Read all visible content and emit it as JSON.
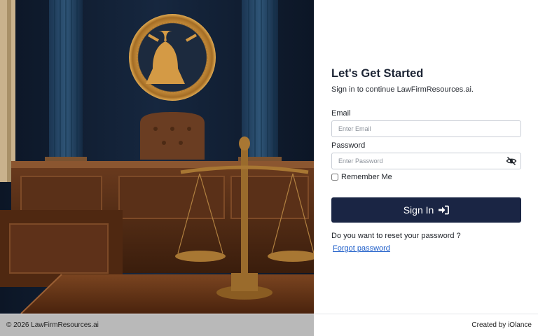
{
  "login": {
    "title": "Let's Get Started",
    "subtitle": "Sign in to continue LawFirmResources.ai.",
    "email_label": "Email",
    "email_placeholder": "Enter Email",
    "email_value": "",
    "password_label": "Password",
    "password_placeholder": "Enter Password",
    "password_value": "",
    "password_toggle_icon": "eye-slash-icon",
    "remember_label": "Remember Me",
    "remember_checked": false,
    "signin_label": "Sign In",
    "signin_icon": "sign-in-arrow-icon",
    "reset_question": "Do you want to reset your password ?",
    "forgot_link": "Forgot password"
  },
  "footer": {
    "copyright": "© 2026 LawFirmResources.ai",
    "credit": "Created by iOlance"
  },
  "colors": {
    "primary_button": "#1a2544",
    "link": "#1a5bc8",
    "heading": "#1c2434"
  }
}
